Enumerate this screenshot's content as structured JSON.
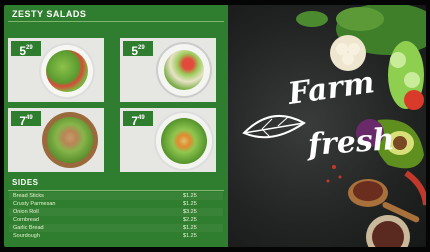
{
  "menu": {
    "title": "ZESTY SALADS",
    "items": [
      {
        "price_main": "5",
        "price_cents": "29"
      },
      {
        "price_main": "5",
        "price_cents": "29"
      },
      {
        "price_main": "7",
        "price_cents": "49"
      },
      {
        "price_main": "7",
        "price_cents": "49"
      }
    ]
  },
  "sides": {
    "title": "SIDES",
    "items": [
      {
        "name": "Bread Sticks",
        "price": "$1.25"
      },
      {
        "name": "Crusty Parmesan",
        "price": "$1.25"
      },
      {
        "name": "Onion Roll",
        "price": "$3.25"
      },
      {
        "name": "Cornbread",
        "price": "$2.25"
      },
      {
        "name": "Garlic Bread",
        "price": "$1.25"
      },
      {
        "name": "Sourdough",
        "price": "$1.25"
      }
    ]
  },
  "promo": {
    "line1": "Farm",
    "line2": "fresh"
  },
  "colors": {
    "menu_green": "#2f7d2e",
    "text_light": "#e9f3d3",
    "photo_dark": "#222423"
  }
}
